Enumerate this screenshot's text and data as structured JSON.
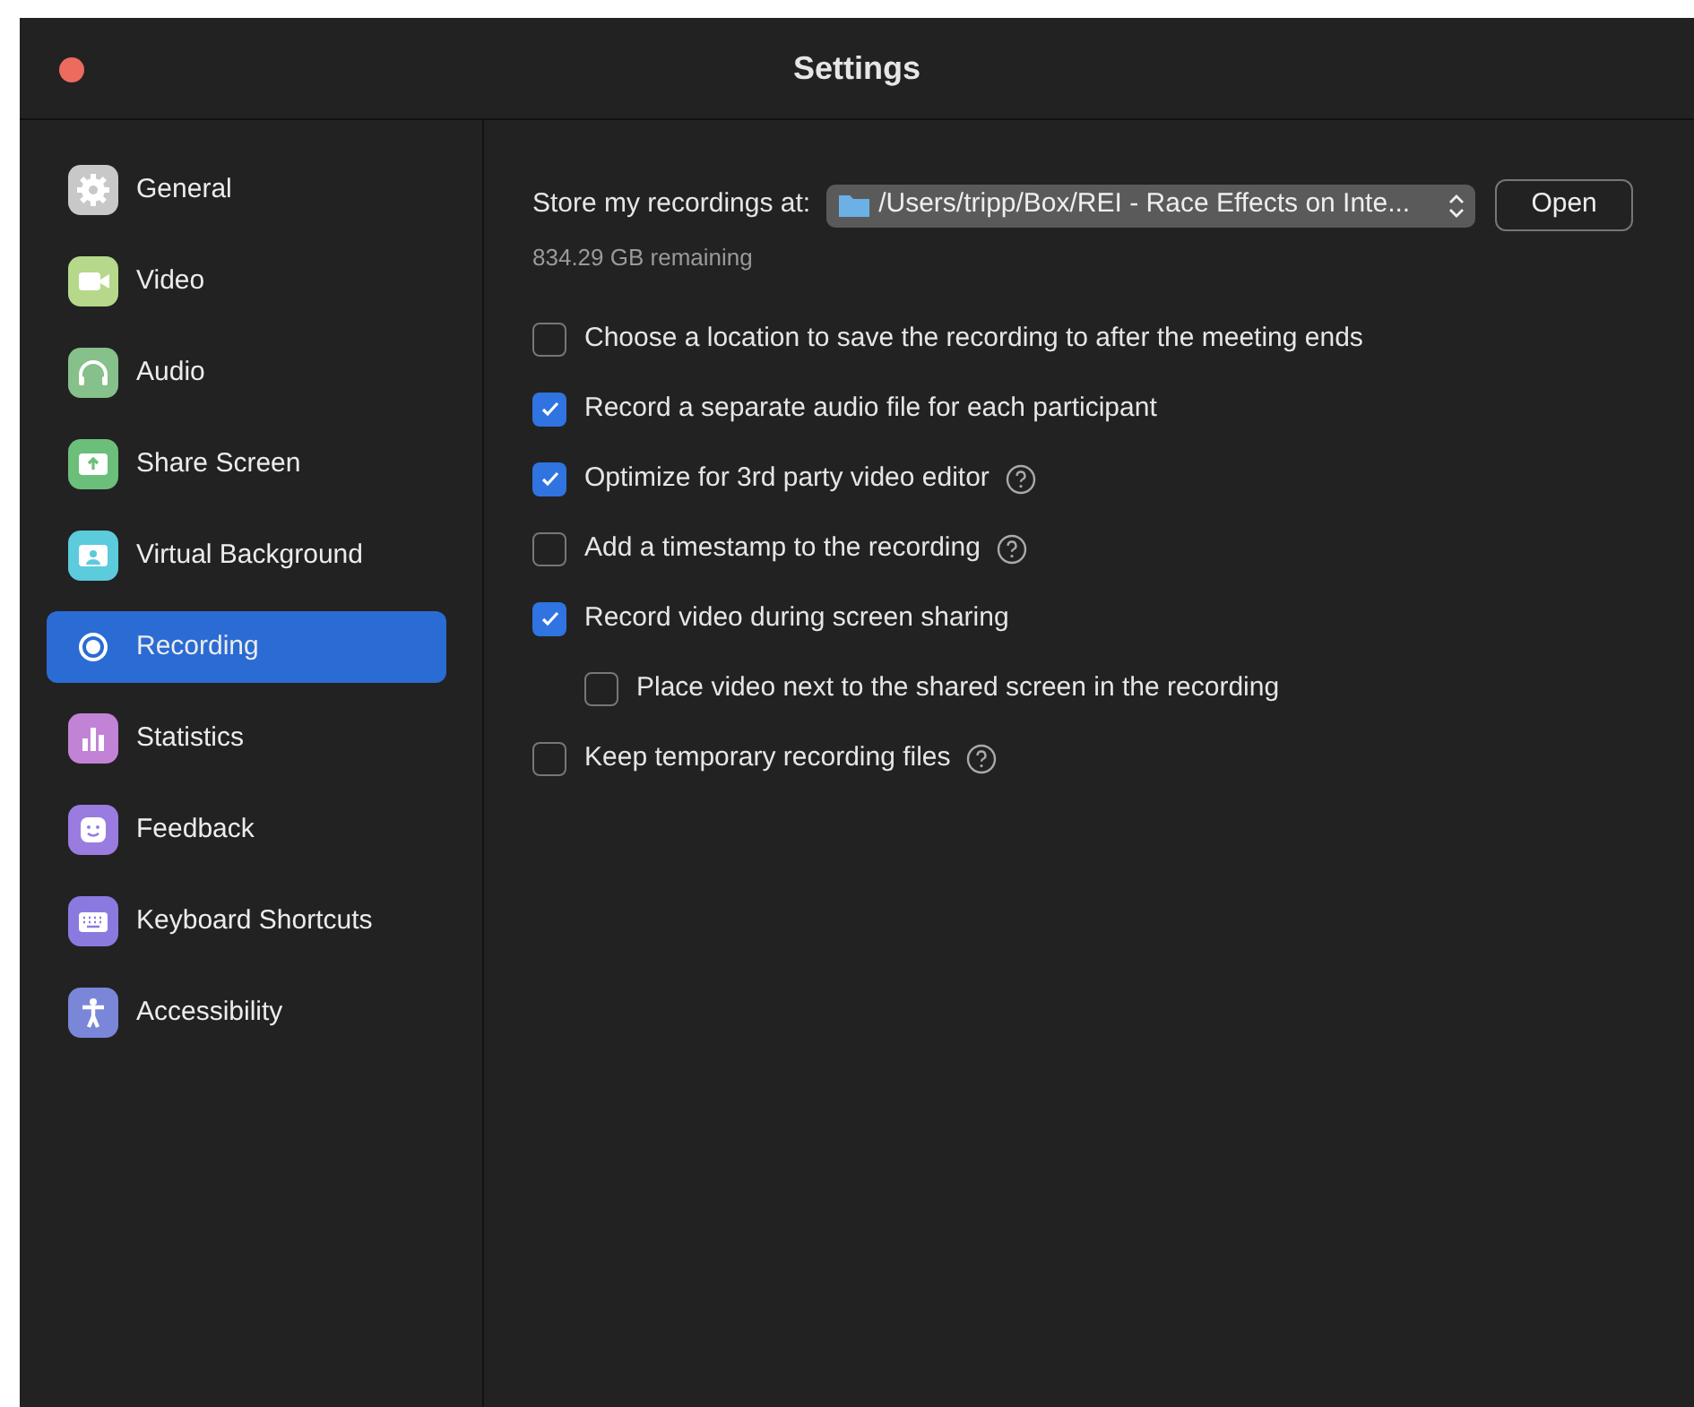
{
  "window": {
    "title": "Settings"
  },
  "sidebar": {
    "items": [
      {
        "label": "General",
        "selected": false,
        "color": "#c8c8c8"
      },
      {
        "label": "Video",
        "selected": false,
        "color": "#b5d88a"
      },
      {
        "label": "Audio",
        "selected": false,
        "color": "#86c08a"
      },
      {
        "label": "Share Screen",
        "selected": false,
        "color": "#6cbf7a"
      },
      {
        "label": "Virtual Background",
        "selected": false,
        "color": "#5ccbdc"
      },
      {
        "label": "Recording",
        "selected": true
      },
      {
        "label": "Statistics",
        "selected": false,
        "color": "#c283d6"
      },
      {
        "label": "Feedback",
        "selected": false,
        "color": "#9a7be0"
      },
      {
        "label": "Keyboard Shortcuts",
        "selected": false,
        "color": "#8a7ae0"
      },
      {
        "label": "Accessibility",
        "selected": false,
        "color": "#7a86d8"
      }
    ]
  },
  "storage": {
    "label": "Store my recordings at:",
    "path": "/Users/tripp/Box/REI - Race Effects on Inte...",
    "open_button": "Open",
    "remaining": "834.29 GB remaining"
  },
  "options": [
    {
      "label": "Choose a location to save the recording to after the meeting ends",
      "checked": false,
      "help": false
    },
    {
      "label": "Record a separate audio file for each participant",
      "checked": true,
      "help": false
    },
    {
      "label": "Optimize for 3rd party video editor",
      "checked": true,
      "help": true
    },
    {
      "label": "Add a timestamp to the recording",
      "checked": false,
      "help": true
    },
    {
      "label": "Record video during screen sharing",
      "checked": true,
      "help": false,
      "children": [
        {
          "label": "Place video next to the shared screen in the recording",
          "checked": false,
          "help": false
        }
      ]
    },
    {
      "label": "Keep temporary recording files",
      "checked": false,
      "help": true
    }
  ]
}
